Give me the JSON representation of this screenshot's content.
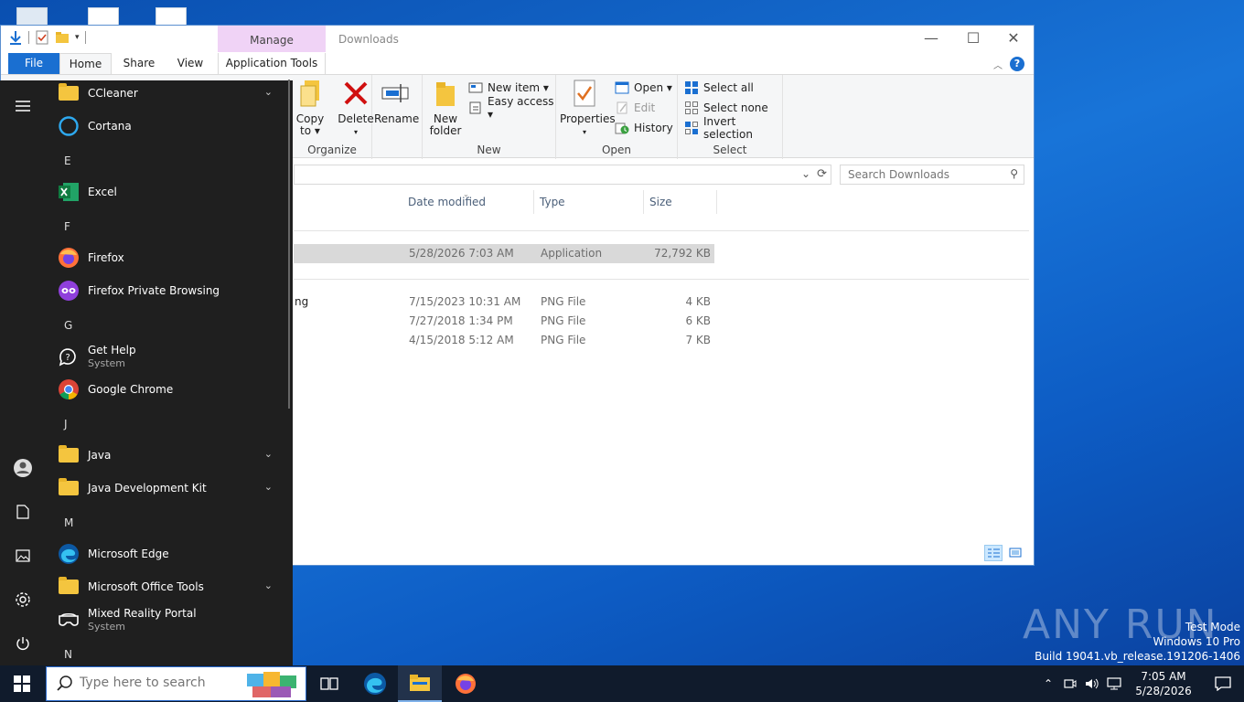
{
  "explorer": {
    "title": "Downloads",
    "manage_label": "Manage",
    "tabs": {
      "file": "File",
      "home": "Home",
      "share": "Share",
      "view": "View",
      "app_tools": "Application Tools"
    },
    "ribbon": {
      "copy_to": "Copy",
      "copy_to_line2": "to ▾",
      "delete": "Delete",
      "rename": "Rename",
      "organize_label": "Organize",
      "new_folder_line1": "New",
      "new_folder_line2": "folder",
      "new_item": "New item ▾",
      "easy_access": "Easy access ▾",
      "new_label": "New",
      "properties": "Properties",
      "open": "Open ▾",
      "edit": "Edit",
      "history": "History",
      "open_label": "Open",
      "select_all": "Select all",
      "select_none": "Select none",
      "invert_selection": "Invert selection",
      "select_label": "Select"
    },
    "search_placeholder": "Search Downloads",
    "columns": {
      "date": "Date modified",
      "type": "Type",
      "size": "Size"
    },
    "files": [
      {
        "name": "",
        "date": "5/28/2026 7:03 AM",
        "type": "Application",
        "size": "72,792 KB",
        "selected": true
      },
      {
        "name": "ng",
        "date": "7/15/2023 10:31 AM",
        "type": "PNG File",
        "size": "4 KB"
      },
      {
        "name": "",
        "date": "7/27/2018 1:34 PM",
        "type": "PNG File",
        "size": "6 KB"
      },
      {
        "name": "",
        "date": "4/15/2018 5:12 AM",
        "type": "PNG File",
        "size": "7 KB"
      }
    ]
  },
  "start_menu": {
    "items": [
      {
        "kind": "app",
        "name": "CCleaner",
        "icon": "folder-icon",
        "expand": true
      },
      {
        "kind": "app",
        "name": "Cortana",
        "icon": "cortana-icon"
      },
      {
        "kind": "letter",
        "name": "E"
      },
      {
        "kind": "app",
        "name": "Excel",
        "icon": "excel-icon"
      },
      {
        "kind": "letter",
        "name": "F"
      },
      {
        "kind": "app",
        "name": "Firefox",
        "icon": "firefox-icon"
      },
      {
        "kind": "app",
        "name": "Firefox Private Browsing",
        "icon": "firefox-private-icon"
      },
      {
        "kind": "letter",
        "name": "G"
      },
      {
        "kind": "app",
        "name": "Get Help",
        "sub": "System",
        "icon": "get-help-icon"
      },
      {
        "kind": "app",
        "name": "Google Chrome",
        "icon": "chrome-icon"
      },
      {
        "kind": "letter",
        "name": "J"
      },
      {
        "kind": "app",
        "name": "Java",
        "icon": "folder-icon",
        "expand": true
      },
      {
        "kind": "app",
        "name": "Java Development Kit",
        "icon": "folder-icon",
        "expand": true
      },
      {
        "kind": "letter",
        "name": "M"
      },
      {
        "kind": "app",
        "name": "Microsoft Edge",
        "icon": "edge-icon"
      },
      {
        "kind": "app",
        "name": "Microsoft Office Tools",
        "icon": "folder-icon",
        "expand": true
      },
      {
        "kind": "app",
        "name": "Mixed Reality Portal",
        "sub": "System",
        "icon": "mixed-reality-icon"
      },
      {
        "kind": "letter",
        "name": "N"
      }
    ]
  },
  "taskbar": {
    "search_placeholder": "Type here to search",
    "time": "7:05 AM",
    "date": "5/28/2026"
  },
  "watermark": {
    "brand": "ANY RUN",
    "line1": "Test Mode",
    "line2": "Windows 10 Pro",
    "line3": "Build 19041.vb_release.191206-1406"
  },
  "colors": {
    "accent": "#1a6fd1",
    "manage_tab": "#f0d3f6",
    "start_bg": "#1f1f1f",
    "taskbar_bg": "#101b2c"
  }
}
